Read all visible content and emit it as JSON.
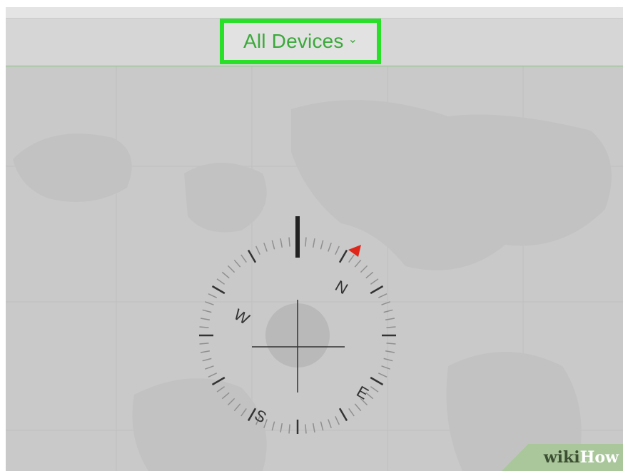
{
  "toolbar": {
    "devices_label": "All Devices",
    "devices_chevron": "⌄"
  },
  "compass": {
    "north_label": "N",
    "east_label": "E",
    "south_label": "S",
    "west_label": "W",
    "heading_marker_color": "#e0261b",
    "north_indicator_color": "#222222"
  },
  "watermark": {
    "part1": "wiki",
    "part2": "How"
  },
  "colors": {
    "highlight": "#29e029",
    "accent_text": "#3aa93a",
    "map_background": "#c9c9c9"
  }
}
